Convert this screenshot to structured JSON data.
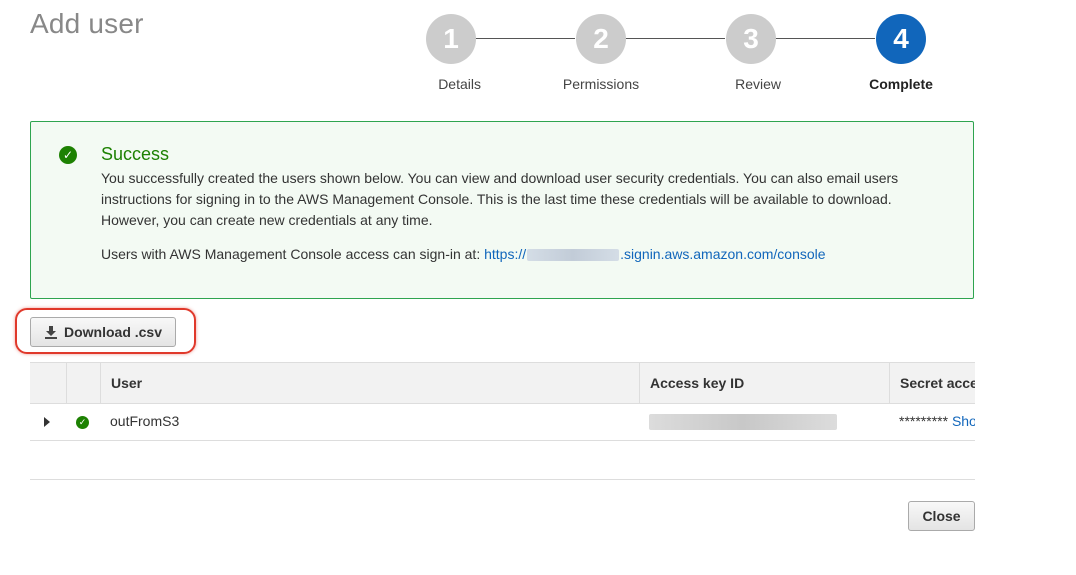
{
  "header": {
    "title": "Add user"
  },
  "steps": [
    {
      "number": "1",
      "label": "Details",
      "active": false
    },
    {
      "number": "2",
      "label": "Permissions",
      "active": false
    },
    {
      "number": "3",
      "label": "Review",
      "active": false
    },
    {
      "number": "4",
      "label": "Complete",
      "active": true
    }
  ],
  "alert": {
    "title": "Success",
    "body": "You successfully created the users shown below. You can view and download user security credentials. You can also email users instructions for signing in to the AWS Management Console. This is the last time these credentials will be available to download. However, you can create new credentials at any time.",
    "signin_prefix": "Users with AWS Management Console access can sign-in at:",
    "signin_link_start": "https://",
    "signin_link_end": ".signin.aws.amazon.com/console"
  },
  "toolbar": {
    "download_label": "Download .csv"
  },
  "table": {
    "columns": [
      "User",
      "Access key ID",
      "Secret acce"
    ],
    "rows": [
      {
        "user": "outFromS3",
        "secret_masked": "*********",
        "show_link": "Show"
      }
    ]
  },
  "footer": {
    "close_label": "Close"
  },
  "colors": {
    "accent": "#1166bb",
    "success": "#1d8102",
    "highlight": "#e0392b"
  }
}
